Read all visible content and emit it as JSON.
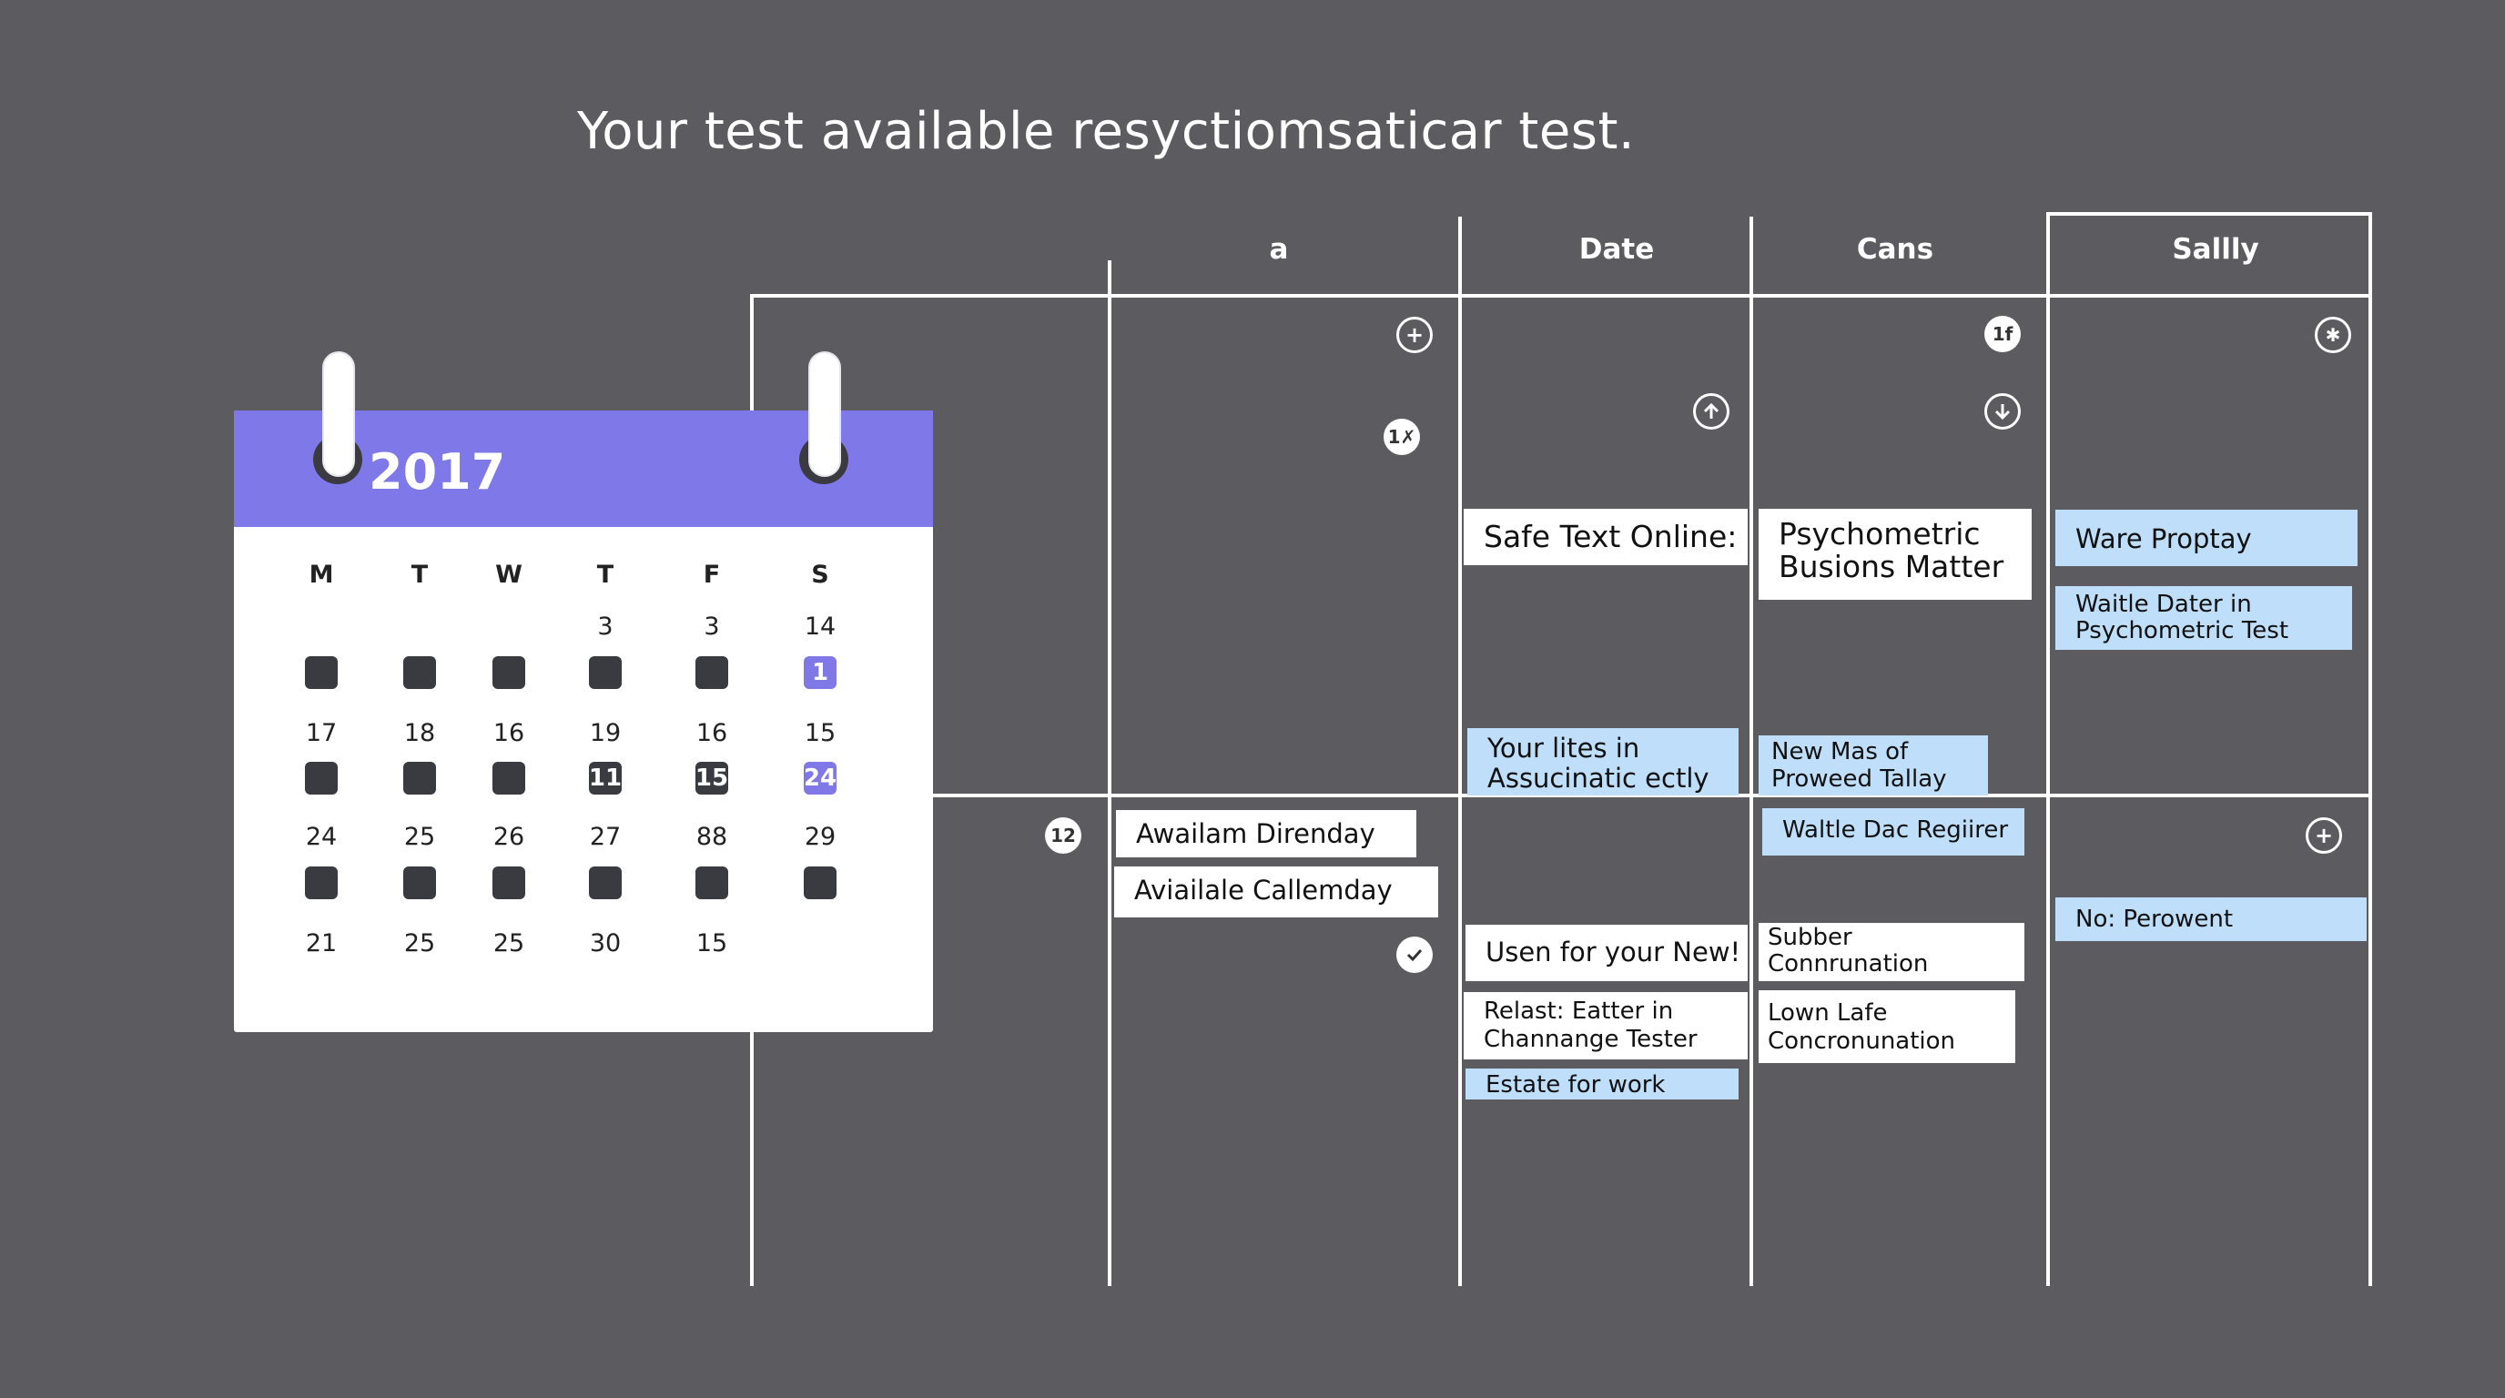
{
  "page": {
    "title": "Your test available resyctiomsaticar test."
  },
  "table": {
    "headers": [
      "a",
      "Date",
      "Cans",
      "Sallly"
    ]
  },
  "icons": {
    "plus_1": "+",
    "badge_1x": "1✗",
    "badge_1f": "1f",
    "badge_12": "12",
    "asterisk": "✱",
    "plus_2": "+"
  },
  "cards": {
    "safe_text": "Safe Text Online:",
    "psych_busions": "Psychometric\nBusions Matter",
    "ware_proptay": "Ware Proptay",
    "waltle_dater": "Waitle Dater in\nPsychometric Test",
    "your_lites": "Your lites in\nAssucinatic ectly",
    "new_mas": "New Mas of\nProweed Tallay",
    "awailam": "Awailam Direnday",
    "aviailale": "Aviailale Callemday",
    "waltle_dac": "Waltle Dac Regiirer",
    "no_perowent": "No: Perowent",
    "usen": "Usen for your New!",
    "subber": "Subber\nConnrunation",
    "relast": "Relast: Eatter in\nChannange Tester",
    "lown_lafe": "Lown Lafe\nConcronunation",
    "estate": "Estate for work"
  },
  "calendar": {
    "year": "2017",
    "days_of_week": [
      "M",
      "T",
      "W",
      "T",
      "F",
      "S"
    ],
    "rows": [
      {
        "numbers": [
          "",
          "",
          "",
          "3",
          "3",
          "14"
        ],
        "dots": [
          {
            "label": "",
            "style": "dark"
          },
          {
            "label": "",
            "style": "dark"
          },
          {
            "label": "",
            "style": "dark"
          },
          {
            "label": "",
            "style": "dark"
          },
          {
            "label": "",
            "style": "dark"
          },
          {
            "label": "1",
            "style": "purple"
          }
        ]
      },
      {
        "numbers": [
          "17",
          "18",
          "16",
          "19",
          "16",
          "15"
        ],
        "dots": [
          {
            "label": "",
            "style": "dark"
          },
          {
            "label": "",
            "style": "dark"
          },
          {
            "label": "",
            "style": "dark"
          },
          {
            "label": "11",
            "style": "dark"
          },
          {
            "label": "15",
            "style": "dark"
          },
          {
            "label": "24",
            "style": "purple"
          }
        ]
      },
      {
        "numbers": [
          "24",
          "25",
          "26",
          "27",
          "88",
          "29"
        ],
        "dots": [
          {
            "label": "",
            "style": "dark"
          },
          {
            "label": "",
            "style": "dark"
          },
          {
            "label": "",
            "style": "dark"
          },
          {
            "label": "",
            "style": "dark"
          },
          {
            "label": "",
            "style": "dark"
          },
          {
            "label": "",
            "style": "dark"
          }
        ]
      },
      {
        "numbers": [
          "21",
          "25",
          "25",
          "30",
          "15",
          ""
        ],
        "dots": []
      }
    ]
  },
  "colors": {
    "background": "#5b5b60",
    "accent": "#7f78e8",
    "card_blue": "#bfdefa",
    "card_white": "#ffffff"
  }
}
